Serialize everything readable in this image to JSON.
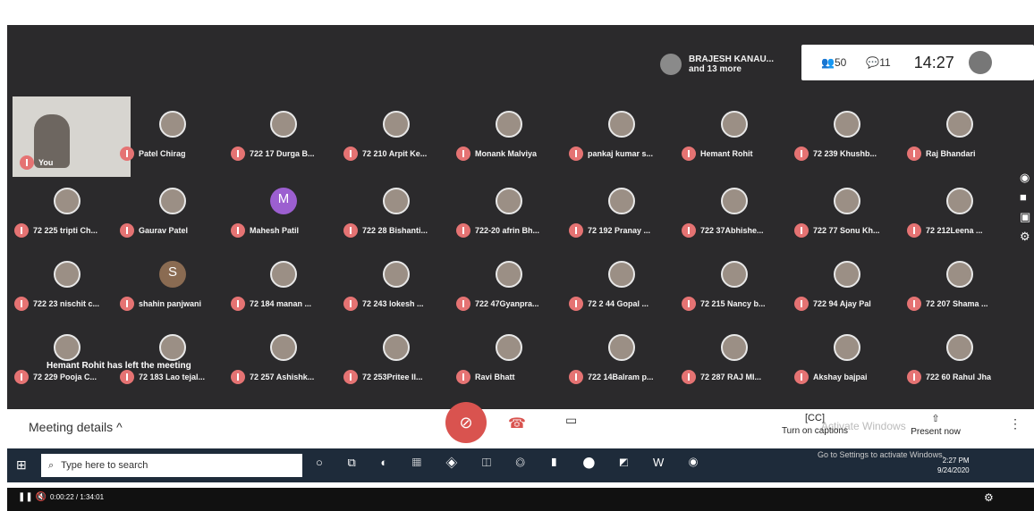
{
  "screen": {
    "top_icons": {
      "hide": "hide-icon",
      "pause": "pause-icon"
    },
    "pinned": {
      "name": "BRAJESH KANAU...",
      "subtitle": "and 13 more"
    },
    "topbar": {
      "people_count": "50",
      "chat_count": "11",
      "time": "14:27"
    },
    "self": {
      "label": "You"
    },
    "tiles": [
      {
        "name": "Patel Chirag",
        "row": 0,
        "col": 1
      },
      {
        "name": "722 17 Durga B...",
        "row": 0,
        "col": 2
      },
      {
        "name": "72 210 Arpit Ke...",
        "row": 0,
        "col": 3
      },
      {
        "name": "Monank Malviya",
        "row": 0,
        "col": 4
      },
      {
        "name": "pankaj kumar s...",
        "row": 0,
        "col": 5
      },
      {
        "name": "Hemant Rohit",
        "row": 0,
        "col": 6
      },
      {
        "name": "72 239 Khushb...",
        "row": 0,
        "col": 7
      },
      {
        "name": "Raj Bhandari",
        "row": 0,
        "col": 8
      },
      {
        "name": "72 225 tripti Ch...",
        "row": 1,
        "col": 0
      },
      {
        "name": "Gaurav Patel",
        "row": 1,
        "col": 1
      },
      {
        "name": "Mahesh Patil",
        "row": 1,
        "col": 2,
        "letter": "M"
      },
      {
        "name": "722 28 Bishanti...",
        "row": 1,
        "col": 3
      },
      {
        "name": "722-20 afrin Bh...",
        "row": 1,
        "col": 4
      },
      {
        "name": "72 192 Pranay ...",
        "row": 1,
        "col": 5
      },
      {
        "name": "722 37Abhishe...",
        "row": 1,
        "col": 6
      },
      {
        "name": "722 77 Sonu Kh...",
        "row": 1,
        "col": 7
      },
      {
        "name": "72 212Leena ...",
        "row": 1,
        "col": 8
      },
      {
        "name": "722 23 nischit c...",
        "row": 2,
        "col": 0
      },
      {
        "name": "shahin panjwani",
        "row": 2,
        "col": 1,
        "letter": "S"
      },
      {
        "name": "72 184 manan ...",
        "row": 2,
        "col": 2
      },
      {
        "name": "72 243 lokesh ...",
        "row": 2,
        "col": 3
      },
      {
        "name": "722 47Gyanpra...",
        "row": 2,
        "col": 4
      },
      {
        "name": "72 2 44 Gopal ...",
        "row": 2,
        "col": 5
      },
      {
        "name": "72 215 Nancy b...",
        "row": 2,
        "col": 6
      },
      {
        "name": "722 94 Ajay Pal",
        "row": 2,
        "col": 7
      },
      {
        "name": "72 207 Shama ...",
        "row": 2,
        "col": 8
      },
      {
        "name": "72 229 Pooja C...",
        "row": 3,
        "col": 0
      },
      {
        "name": "72 183 Lao tejal...",
        "row": 3,
        "col": 1
      },
      {
        "name": "72 257 Ashishk...",
        "row": 3,
        "col": 2
      },
      {
        "name": "72 253Pritee II...",
        "row": 3,
        "col": 3
      },
      {
        "name": "Ravi Bhatt",
        "row": 3,
        "col": 4
      },
      {
        "name": "722 14Balram p...",
        "row": 3,
        "col": 5
      },
      {
        "name": "72 287 RAJ MI...",
        "row": 3,
        "col": 6
      },
      {
        "name": "Akshay bajpai",
        "row": 3,
        "col": 7
      },
      {
        "name": "722 60 Rahul Jha",
        "row": 3,
        "col": 8
      }
    ],
    "left_message": "Hemant Rohit has left the meeting"
  },
  "bottom_bar": {
    "meeting_details": "Meeting details",
    "captions_label": "Turn on captions",
    "present_label": "Present now",
    "watermark_title": "Activate Windows",
    "watermark_sub": "Go to Settings to activate Windows."
  },
  "taskbar": {
    "search_placeholder": "Type here to search",
    "time": "2:27 PM",
    "date": "9/24/2020"
  },
  "player": {
    "timecode": "0:00:22 / 1:34:01"
  }
}
